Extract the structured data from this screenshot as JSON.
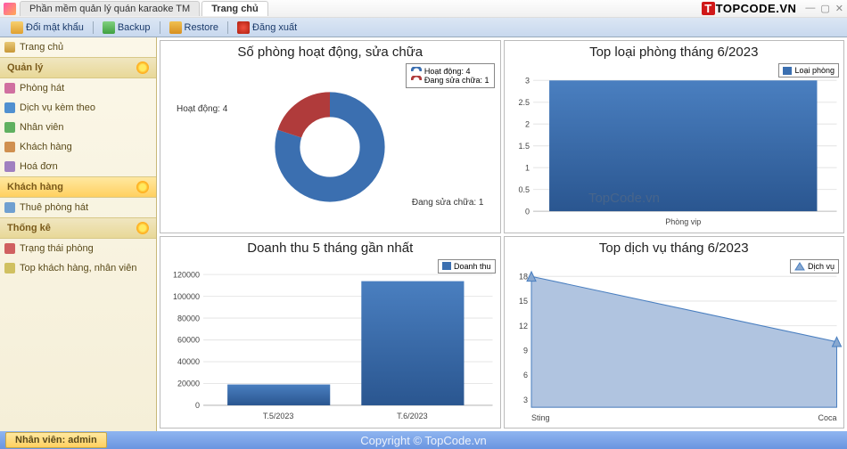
{
  "window": {
    "app_title": "Phần mềm quản lý quán karaoke TM",
    "tab_home": "Trang chủ",
    "logo_t": "T",
    "logo_rest": "TOPCODE.VN"
  },
  "toolbar": {
    "change_pw": "Đổi mật khẩu",
    "backup": "Backup",
    "restore": "Restore",
    "logout": "Đăng xuất"
  },
  "sidebar": {
    "home": "Trang chủ",
    "manage": "Quản lý",
    "manage_items": [
      "Phòng hát",
      "Dịch vụ kèm theo",
      "Nhân viên",
      "Khách hàng",
      "Hoá đơn"
    ],
    "customer": "Khách hàng",
    "customer_items": [
      "Thuê phòng hát"
    ],
    "stats": "Thống kê",
    "stats_items": [
      "Trạng thái phòng",
      "Top khách hàng, nhân viên"
    ]
  },
  "panels": {
    "p1_title": "Số phòng hoạt động, sửa chữa",
    "p1_legend_a": "Hoạt động: 4",
    "p1_legend_b": "Đang sửa chữa: 1",
    "p1_call_a": "Hoạt động: 4",
    "p1_call_b": "Đang sửa chữa: 1",
    "p2_title": "Top loại phòng tháng 6/2023",
    "p2_legend": "Loại phòng",
    "p2_xlabel": "Phòng vip",
    "p3_title": "Doanh thu 5 tháng gần nhất",
    "p3_legend": "Doanh thu",
    "p4_title": "Top dịch vụ tháng 6/2023",
    "p4_legend": "Dịch vụ"
  },
  "status": {
    "user_label": "Nhân viên: admin",
    "copyright": "Copyright © TopCode.vn"
  },
  "watermark": "TopCode.vn",
  "chart_data": [
    {
      "type": "pie",
      "title": "Số phòng hoạt động, sửa chữa",
      "series": [
        {
          "name": "Hoạt động",
          "value": 4,
          "color": "#3b6fb0"
        },
        {
          "name": "Đang sửa chữa",
          "value": 1,
          "color": "#b03b3b"
        }
      ]
    },
    {
      "type": "bar",
      "title": "Top loại phòng tháng 6/2023",
      "categories": [
        "Phòng vip"
      ],
      "series": [
        {
          "name": "Loại phòng",
          "values": [
            3
          ],
          "color": "#3b6fb0"
        }
      ],
      "ylim": [
        0,
        3
      ],
      "yticks": [
        0,
        0.5,
        1,
        1.5,
        2,
        2.5,
        3
      ]
    },
    {
      "type": "bar",
      "title": "Doanh thu 5 tháng gần nhất",
      "categories": [
        "T.5/2023",
        "T.6/2023"
      ],
      "series": [
        {
          "name": "Doanh thu",
          "values": [
            19000,
            114000
          ],
          "color": "#3b6fb0"
        }
      ],
      "ylim": [
        0,
        120000
      ],
      "yticks": [
        0,
        20000,
        40000,
        60000,
        80000,
        100000,
        120000
      ]
    },
    {
      "type": "area",
      "title": "Top dịch vụ tháng 6/2023",
      "x": [
        "Sting",
        "Coca"
      ],
      "series": [
        {
          "name": "Dịch vụ",
          "values": [
            18,
            10
          ],
          "color": "#88a8d0"
        }
      ],
      "ylim": [
        0,
        18
      ],
      "yticks": [
        3,
        6,
        9,
        12,
        15,
        18
      ]
    }
  ]
}
